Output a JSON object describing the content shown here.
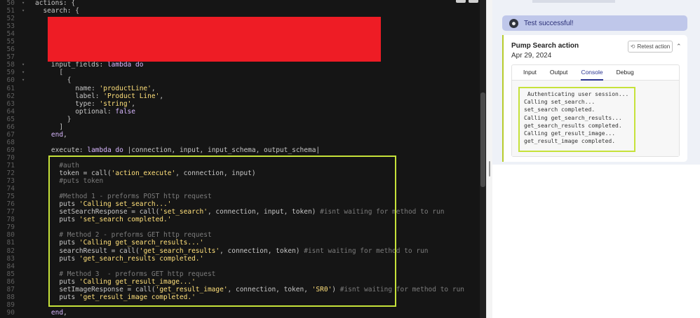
{
  "editor": {
    "lines": [
      {
        "n": "50",
        "fold": "▾",
        "parts": [
          [
            "",
            "actions: {"
          ]
        ]
      },
      {
        "n": "51",
        "fold": "▾",
        "parts": [
          [
            "",
            "  search: {"
          ]
        ]
      },
      {
        "n": "52",
        "fold": "",
        "parts": []
      },
      {
        "n": "53",
        "fold": "",
        "parts": []
      },
      {
        "n": "54",
        "fold": "",
        "parts": []
      },
      {
        "n": "55",
        "fold": "",
        "parts": []
      },
      {
        "n": "56",
        "fold": "",
        "parts": []
      },
      {
        "n": "57",
        "fold": "",
        "parts": []
      },
      {
        "n": "58",
        "fold": "▾",
        "parts": [
          [
            "",
            "    input_fields: "
          ],
          [
            "kw",
            "lambda"
          ],
          [
            "",
            " "
          ],
          [
            "kw",
            "do"
          ]
        ]
      },
      {
        "n": "59",
        "fold": "▾",
        "parts": [
          [
            "",
            "      ["
          ]
        ]
      },
      {
        "n": "60",
        "fold": "▾",
        "parts": [
          [
            "",
            "        {"
          ]
        ]
      },
      {
        "n": "61",
        "fold": "",
        "parts": [
          [
            "",
            "          name: "
          ],
          [
            "str",
            "'productLine'"
          ],
          [
            "",
            ","
          ]
        ]
      },
      {
        "n": "62",
        "fold": "",
        "parts": [
          [
            "",
            "          label: "
          ],
          [
            "str",
            "'Product Line'"
          ],
          [
            "",
            ","
          ]
        ]
      },
      {
        "n": "63",
        "fold": "",
        "parts": [
          [
            "",
            "          type: "
          ],
          [
            "str",
            "'string'"
          ],
          [
            "",
            ","
          ]
        ]
      },
      {
        "n": "64",
        "fold": "",
        "parts": [
          [
            "",
            "          optional: "
          ],
          [
            "kw",
            "false"
          ]
        ]
      },
      {
        "n": "65",
        "fold": "",
        "parts": [
          [
            "",
            "        }"
          ]
        ]
      },
      {
        "n": "66",
        "fold": "",
        "parts": [
          [
            "",
            "      ]"
          ]
        ]
      },
      {
        "n": "67",
        "fold": "",
        "parts": [
          [
            "",
            "    "
          ],
          [
            "kw",
            "end"
          ],
          [
            "",
            ","
          ]
        ]
      },
      {
        "n": "68",
        "fold": "",
        "parts": []
      },
      {
        "n": "69",
        "fold": "",
        "parts": [
          [
            "",
            "    execute: "
          ],
          [
            "kw",
            "lambda"
          ],
          [
            "",
            " "
          ],
          [
            "kw",
            "do"
          ],
          [
            "",
            " |connection, input, input_schema, output_schema|"
          ]
        ]
      },
      {
        "n": "70",
        "fold": "",
        "parts": []
      },
      {
        "n": "71",
        "fold": "",
        "parts": [
          [
            "com",
            "      #auth"
          ]
        ]
      },
      {
        "n": "72",
        "fold": "",
        "parts": [
          [
            "",
            "      token = call("
          ],
          [
            "str",
            "'action_execute'"
          ],
          [
            "",
            ", connection, input)"
          ]
        ]
      },
      {
        "n": "73",
        "fold": "",
        "parts": [
          [
            "com",
            "      #puts token"
          ]
        ]
      },
      {
        "n": "74",
        "fold": "",
        "parts": []
      },
      {
        "n": "75",
        "fold": "",
        "parts": [
          [
            "com",
            "      #Method 1 - preforms POST http request"
          ]
        ]
      },
      {
        "n": "76",
        "fold": "",
        "parts": [
          [
            "",
            "      puts "
          ],
          [
            "str",
            "'Calling set_search...'"
          ]
        ]
      },
      {
        "n": "77",
        "fold": "",
        "parts": [
          [
            "",
            "      setSearchResponse = call("
          ],
          [
            "str",
            "'set_search'"
          ],
          [
            "",
            ", connection, input, token) "
          ],
          [
            "com",
            "#isnt waiting for method to run"
          ]
        ]
      },
      {
        "n": "78",
        "fold": "",
        "parts": [
          [
            "",
            "      puts "
          ],
          [
            "str",
            "'set_search completed.'"
          ]
        ]
      },
      {
        "n": "79",
        "fold": "",
        "parts": []
      },
      {
        "n": "80",
        "fold": "",
        "parts": [
          [
            "com",
            "      # Method 2 - preforms GET http request"
          ]
        ]
      },
      {
        "n": "81",
        "fold": "",
        "parts": [
          [
            "",
            "      puts "
          ],
          [
            "str",
            "'Calling get_search_results...'"
          ]
        ]
      },
      {
        "n": "82",
        "fold": "",
        "parts": [
          [
            "",
            "      searchResult = call("
          ],
          [
            "str",
            "'get_search_results'"
          ],
          [
            "",
            ", connection, token) "
          ],
          [
            "com",
            "#isnt waiting for method to run"
          ]
        ]
      },
      {
        "n": "83",
        "fold": "",
        "parts": [
          [
            "",
            "      puts "
          ],
          [
            "str",
            "'get_search_results completed.'"
          ]
        ]
      },
      {
        "n": "84",
        "fold": "",
        "parts": []
      },
      {
        "n": "85",
        "fold": "",
        "parts": [
          [
            "com",
            "      # Method 3  - preforms GET http request"
          ]
        ]
      },
      {
        "n": "86",
        "fold": "",
        "parts": [
          [
            "",
            "      puts "
          ],
          [
            "str",
            "'Calling get_result_image...'"
          ]
        ]
      },
      {
        "n": "87",
        "fold": "",
        "parts": [
          [
            "",
            "      setImageResponse = call("
          ],
          [
            "str",
            "'get_result_image'"
          ],
          [
            "",
            ", connection, token, "
          ],
          [
            "str",
            "'SR0'"
          ],
          [
            "",
            ") "
          ],
          [
            "com",
            "#isnt waiting for method to run"
          ]
        ]
      },
      {
        "n": "88",
        "fold": "",
        "parts": [
          [
            "",
            "      puts "
          ],
          [
            "str",
            "'get_result_image completed.'"
          ]
        ]
      },
      {
        "n": "89",
        "fold": "",
        "parts": []
      },
      {
        "n": "90",
        "fold": "",
        "parts": [
          [
            "",
            "    "
          ],
          [
            "kw",
            "end"
          ],
          [
            "",
            ","
          ]
        ]
      }
    ]
  },
  "panel": {
    "banner_text": "Test successful!",
    "card_title": "Pump Search action",
    "card_date": "Apr 29, 2024",
    "retest_label": "Retest action",
    "tabs": [
      "Input",
      "Output",
      "Console",
      "Debug"
    ],
    "active_tab": "Console",
    "console_lines": [
      " Authenticating user session...",
      "Calling set_search...",
      "set_search completed.",
      "Calling get_search_results...",
      "get_search_results completed.",
      "Calling get_result_image...",
      "get_result_image completed."
    ]
  },
  "colors": {
    "highlight_border": "#c6e23a",
    "redaction": "#ee1c25",
    "accent": "#2c3691",
    "banner_bg": "#bfc7ea"
  }
}
